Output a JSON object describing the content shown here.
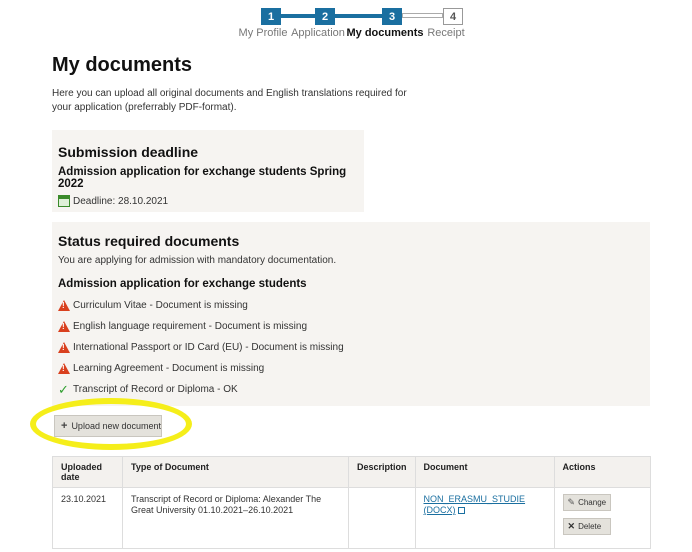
{
  "stepper": {
    "steps": [
      {
        "number": "1",
        "label": "My Profile"
      },
      {
        "number": "2",
        "label": "Application"
      },
      {
        "number": "3",
        "label": "My documents"
      },
      {
        "number": "4",
        "label": "Receipt"
      }
    ]
  },
  "page": {
    "title": "My documents",
    "intro": "Here you can upload all original documents and English translations required for your application (preferrably PDF-format)."
  },
  "deadline": {
    "heading": "Submission deadline",
    "application": "Admission application for exchange students Spring 2022",
    "deadline_text": "Deadline: 28.10.2021"
  },
  "status": {
    "heading": "Status required documents",
    "subtitle": "You are applying for admission with mandatory documentation.",
    "application": "Admission application for exchange students",
    "items": [
      {
        "text": "Curriculum Vitae - Document is missing",
        "state": "missing"
      },
      {
        "text": "English language requirement - Document is missing",
        "state": "missing"
      },
      {
        "text": "International Passport or ID Card (EU) - Document is missing",
        "state": "missing"
      },
      {
        "text": "Learning Agreement - Document is missing",
        "state": "missing"
      },
      {
        "text": "Transcript of Record or Diploma - OK",
        "state": "ok"
      }
    ]
  },
  "upload": {
    "label": "Upload new document"
  },
  "table": {
    "headers": {
      "uploaded": "Uploaded date",
      "type": "Type of Document",
      "description": "Description",
      "document": "Document",
      "actions": "Actions"
    },
    "rows": [
      {
        "uploaded": "23.10.2021",
        "type": "Transcript of Record or Diploma: Alexander The Great University 01.10.2021–26.10.2021",
        "description": "",
        "document": "NON_ERASMU_STUDIE (DOCX)",
        "change_label": "Change",
        "delete_label": "Delete"
      }
    ]
  },
  "colors": {
    "step_active": "#1a6fa0",
    "warning": "#d9401e",
    "ok": "#2e9e2e",
    "highlight": "#f5ee1a"
  }
}
